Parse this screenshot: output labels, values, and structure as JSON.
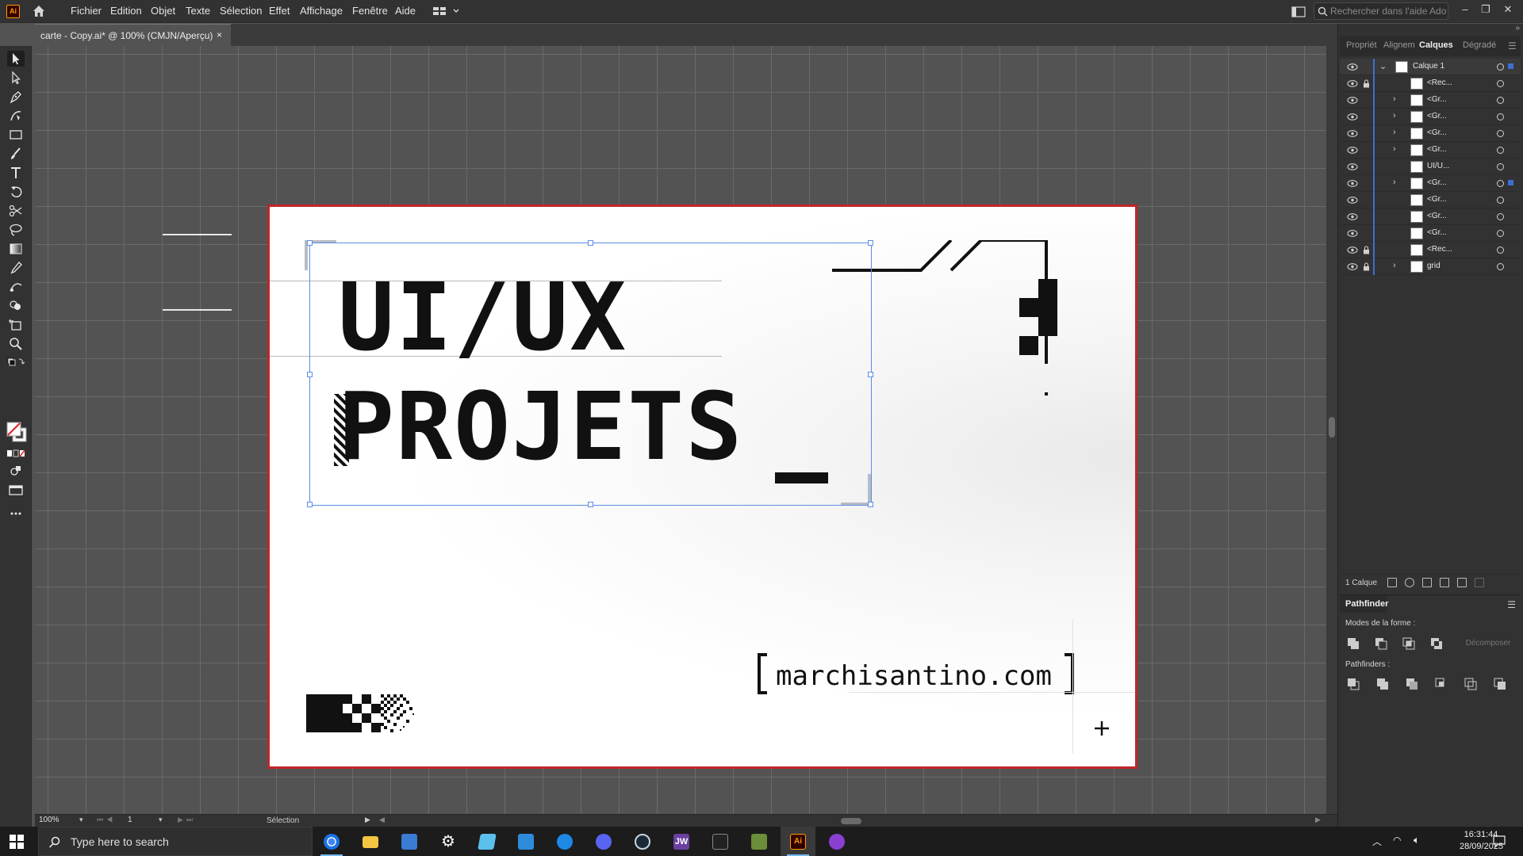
{
  "app": {
    "logo_text": "Ai",
    "menu": [
      "Fichier",
      "Edition",
      "Objet",
      "Texte",
      "Sélection",
      "Effet",
      "Affichage",
      "Fenêtre",
      "Aide"
    ],
    "search_placeholder": "Rechercher dans l'aide Adobe"
  },
  "document": {
    "tab_title": "carte - Copy.ai* @ 100% (CMJN/Aperçu)",
    "close_glyph": "×"
  },
  "artboard": {
    "headline_line1": "UI/UX",
    "headline_line2": "PROJETS",
    "website": "marchisantino.com",
    "border_color": "#c0252b"
  },
  "panels": {
    "tabs": [
      "Propriét",
      "Alignem",
      "Calques",
      "Dégradé"
    ],
    "active_tab": "Calques",
    "layers": [
      {
        "name": "Calque 1",
        "locked": false,
        "expandable": true,
        "expanded": true,
        "is_layer": true
      },
      {
        "name": "<Rec...",
        "locked": true,
        "expandable": false
      },
      {
        "name": "<Gr...",
        "locked": false,
        "expandable": true
      },
      {
        "name": "<Gr...",
        "locked": false,
        "expandable": true
      },
      {
        "name": "<Gr...",
        "locked": false,
        "expandable": true
      },
      {
        "name": "<Gr...",
        "locked": false,
        "expandable": true
      },
      {
        "name": "UI/U...",
        "locked": false,
        "expandable": false
      },
      {
        "name": "<Gr...",
        "locked": false,
        "expandable": true,
        "selected": true
      },
      {
        "name": "<Gr...",
        "locked": false,
        "expandable": false
      },
      {
        "name": "<Gr...",
        "locked": false,
        "expandable": false
      },
      {
        "name": "<Gr...",
        "locked": false,
        "expandable": false
      },
      {
        "name": "<Rec...",
        "locked": true,
        "expandable": false
      },
      {
        "name": "grid",
        "locked": true,
        "expandable": true
      }
    ],
    "layers_count": "1 Calque",
    "pathfinder": {
      "title": "Pathfinder",
      "shape_modes_label": "Modes de la forme :",
      "pathfinders_label": "Pathfinders :",
      "expand_label": "Décomposer"
    }
  },
  "status": {
    "zoom": "100%",
    "artboard_number": "1",
    "tool_name": "Sélection"
  },
  "taskbar": {
    "search_text": "Type here to search",
    "time": "16:31:44",
    "date": "28/09/2025",
    "apps": [
      "chrome",
      "file-explorer",
      "calculator",
      "settings",
      "notepad",
      "store",
      "headset-app",
      "discord",
      "steam",
      "jw",
      "terminal",
      "minecraft",
      "illustrator",
      "app-purple"
    ]
  }
}
